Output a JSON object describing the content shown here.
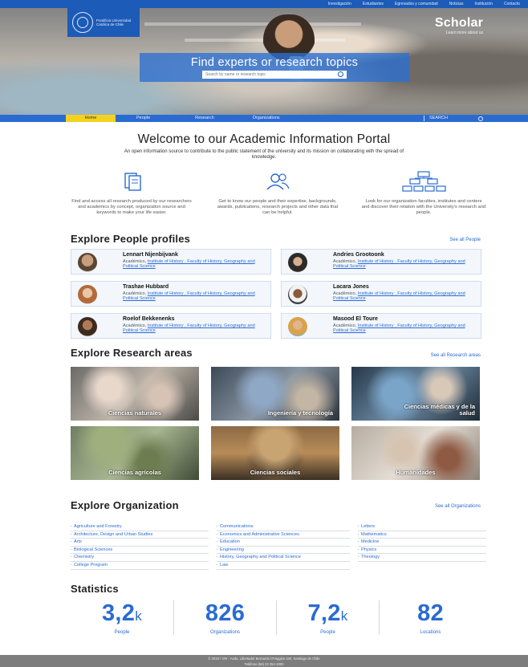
{
  "top_links": [
    "Investigación",
    "Estudiantes",
    "Egresados y comunidad",
    "Noticias",
    "Institución",
    "Contacto"
  ],
  "logo": {
    "name": "Pontificia Universidad Católica de Chile"
  },
  "brand": {
    "name": "Scholar",
    "tagline": "Learn more about us"
  },
  "hero": {
    "title": "Find experts or research topics",
    "search_placeholder": "Search by name or research topic"
  },
  "main_nav": {
    "tabs": [
      "Home",
      "People",
      "Research",
      "Organizations"
    ],
    "active": "Home",
    "search_label": "SEARCH"
  },
  "welcome": {
    "title": "Welcome to our Academic Information Portal",
    "subtitle": "An open information source to contribute to the public statement of the university and its mission on collaborating with the spread of knowledge."
  },
  "features": [
    {
      "icon": "documents-icon",
      "text": "Find and access all research produced by our researchers and academics by concept, organization source and keywords to make your life easier."
    },
    {
      "icon": "people-icon",
      "text": "Get to know our people and their expertise, backgrounds, awards, publications, research projects and other data that can be helpful."
    },
    {
      "icon": "organization-chart-icon",
      "text": "Look for our organization faculties, institutes and centers and discover their relation with the University's research and people."
    }
  ],
  "people": {
    "title": "Explore People profiles",
    "see_all": "See all People",
    "profiles": [
      {
        "name": "Lennart Nijenbijvank",
        "role": "Académico,",
        "affiliation": "Institute of History , Faculty of History, Geography and Political Science"
      },
      {
        "name": "Andries Grootoonk",
        "role": "Académico,",
        "affiliation": "Institute of History , Faculty of History, Geography and Political Science"
      },
      {
        "name": "Trashae Hubbard",
        "role": "Académico,",
        "affiliation": "Institute of History , Faculty of History, Geography and Political Science"
      },
      {
        "name": "Lacara Jones",
        "role": "Académico,",
        "affiliation": "Institute of History , Faculty of History, Geography and Political Science"
      },
      {
        "name": "Roelof Bekkenenks",
        "role": "Académico,",
        "affiliation": "Institute of History , Faculty of History, Geography and Political Science"
      },
      {
        "name": "Masood El Toure",
        "role": "Académico,",
        "affiliation": "Institute of History , Faculty of History, Geography and Political Science"
      }
    ]
  },
  "research": {
    "title": "Explore Research areas",
    "see_all": "See all Research areas",
    "areas": [
      "Ciencias naturales",
      "Ingeniería y tecnología",
      "Ciencias médicas y de la salud",
      "Ciencias agrícolas",
      "Ciencias sociales",
      "Humanidades"
    ]
  },
  "organization": {
    "title": "Explore Organization",
    "see_all": "See all Organizations",
    "columns": [
      [
        "Agriculture and Forestry",
        "Architecture, Design and Urban Studies",
        "Arts",
        "Biological Sciences",
        "Chemistry",
        "College Program"
      ],
      [
        "Communications",
        "Economics and Administrative Sciences",
        "Education",
        "Engineering",
        "History, Geography and Political Science",
        "Law"
      ],
      [
        "Letters",
        "Mathematics",
        "Medicine",
        "Physics",
        "Theology"
      ]
    ]
  },
  "statistics": {
    "title": "Statistics",
    "items": [
      {
        "value": "3,2",
        "suffix": "k",
        "label": "People"
      },
      {
        "value": "826",
        "suffix": "",
        "label": "Organizations"
      },
      {
        "value": "7,2",
        "suffix": "k",
        "label": "People"
      },
      {
        "value": "82",
        "suffix": "",
        "label": "Locations"
      }
    ]
  },
  "footer": {
    "line1": "© 2019 / VRI - Avda. Libertador Bernardo O'Higgins 340, Santiago de Chile",
    "line2": "Teléfono (56) 22 354 2000"
  },
  "colors": {
    "brand_blue": "#2a6bd1",
    "active_tab": "#f4d21f",
    "footer": "#7d7d7d"
  }
}
